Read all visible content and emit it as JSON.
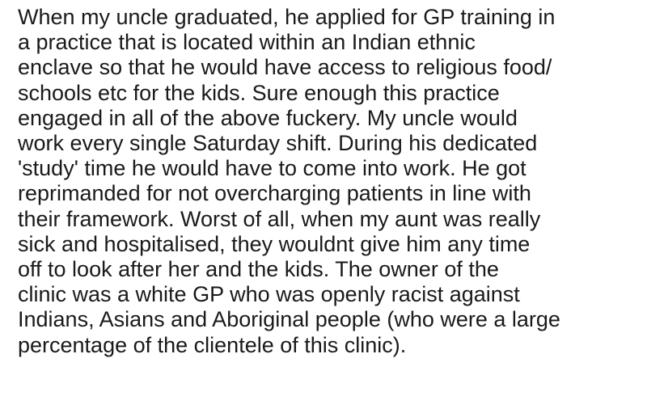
{
  "post": {
    "lines": [
      "When my uncle graduated, he applied for GP training in",
      "a practice that is located within an Indian ethnic",
      "enclave so that he would have access to religious food/",
      "schools etc for the kids. Sure enough this practice",
      "engaged in all of the above fuckery. My uncle would",
      "work every single Saturday shift. During his dedicated",
      "'study' time he would have to come into work. He got",
      "reprimanded for not overcharging patients in line with",
      "their framework. Worst of all, when my aunt was really",
      "sick and hospitalised, they wouldnt give him any time",
      "off to look after her and the kids. The owner of the",
      "clinic was a white GP who was openly racist against",
      "Indians, Asians and Aboriginal people (who were a large",
      "percentage of the clientele of this clinic)."
    ]
  }
}
